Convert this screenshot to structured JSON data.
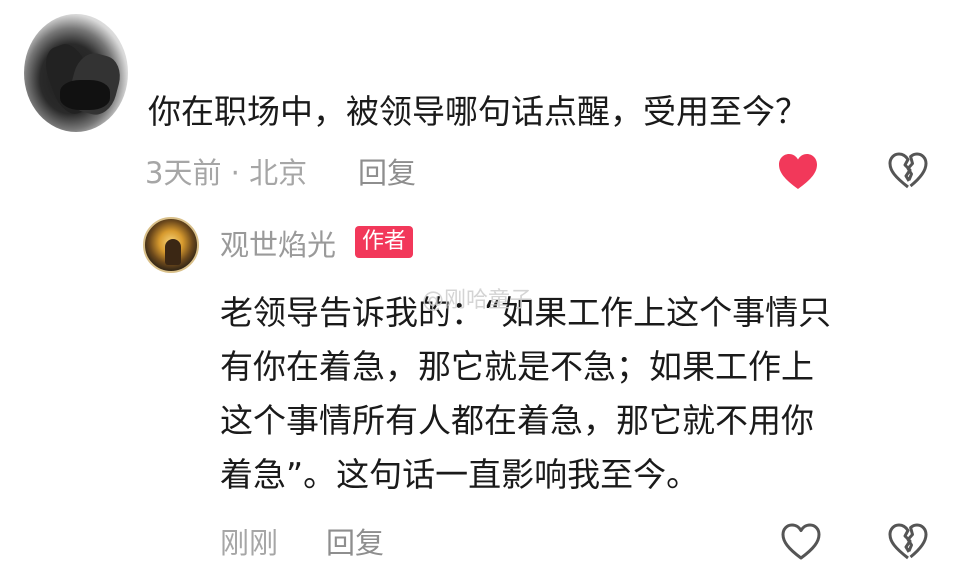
{
  "comment": {
    "question": "你在职场中，被领导哪句话点醒，受用至今？",
    "time_location": "3天前 · 北京",
    "reply_label": "回复",
    "liked": true,
    "like_color": "#f2385a",
    "icons": [
      "avatar",
      "heart-filled-icon",
      "broken-heart-icon"
    ]
  },
  "reply": {
    "author": "观世焰光",
    "badge": "作者",
    "badge_color": "#f2385a",
    "lines": [
      "老领导告诉我的：“如果工作上这个事情只",
      "有你在着急，那它就是不急；如果工作上",
      "这个事情所有人都在着急，那它就不用你",
      "着急”。这句话一直影响我至今。"
    ],
    "time": "刚刚",
    "reply_label": "回复",
    "liked": false,
    "icons": [
      "avatar",
      "heart-outline-icon",
      "broken-heart-icon"
    ]
  },
  "watermark": "@刚哈童子"
}
